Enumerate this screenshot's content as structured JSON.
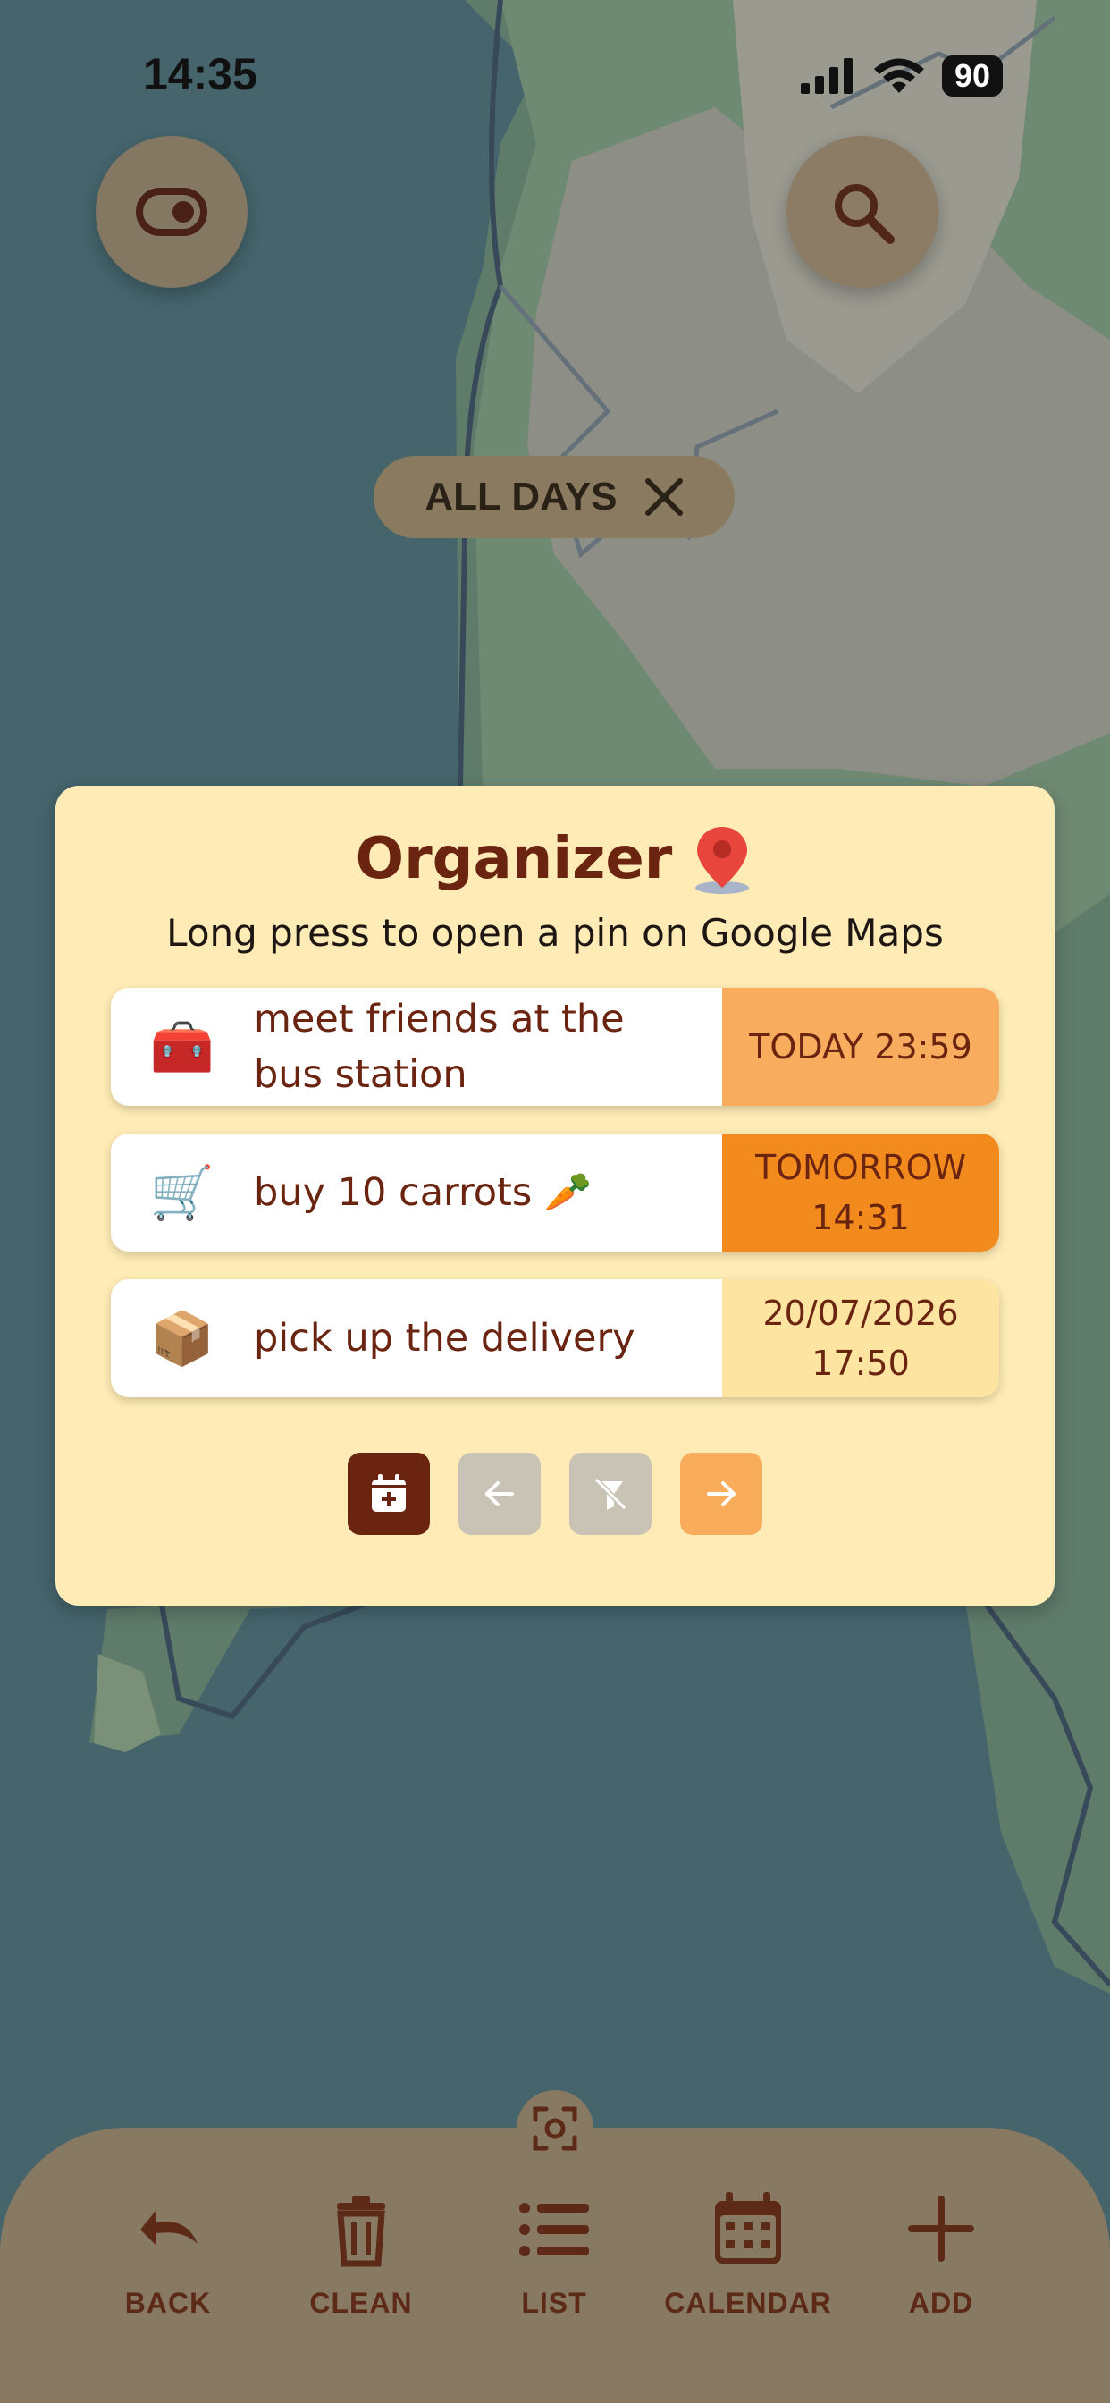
{
  "status_bar": {
    "time": "14:35",
    "battery": "90"
  },
  "top_controls": {
    "toggle_icon": "toggle-icon",
    "search_icon": "search-icon"
  },
  "filter_chip": {
    "label": "ALL DAYS",
    "close_icon": "close-icon"
  },
  "organizer": {
    "title": "Organizer",
    "title_icon": "map-pin-icon",
    "subtitle": "Long press to open a pin on Google Maps",
    "items": [
      {
        "icon": "🧰",
        "icon_name": "treasure-chest-icon",
        "text": "meet friends at the bus station",
        "date": "TODAY 23:59",
        "date_color": "#f8ad5e"
      },
      {
        "icon": "🛒",
        "icon_name": "shopping-cart-icon",
        "text": "buy 10 carrots 🥕",
        "date": "TOMORROW 14:31",
        "date_color": "#f28a1d"
      },
      {
        "icon": "📦",
        "icon_name": "package-icon",
        "text": "pick up the delivery",
        "date": "20/07/2026 17:50",
        "date_color": "#fde4a0"
      }
    ],
    "pager": [
      {
        "name": "calendar-add-icon",
        "color": "#6a2410"
      },
      {
        "name": "arrow-left-icon",
        "color": "#c9c3b6"
      },
      {
        "name": "filter-off-icon",
        "color": "#c9c3b6"
      },
      {
        "name": "arrow-right-icon",
        "color": "#f9ad5a"
      }
    ]
  },
  "bottom_nav": {
    "scan_icon": "scan-icon",
    "items": [
      {
        "label": "BACK",
        "icon": "undo-icon"
      },
      {
        "label": "CLEAN",
        "icon": "trash-icon"
      },
      {
        "label": "LIST",
        "icon": "list-icon"
      },
      {
        "label": "CALENDAR",
        "icon": "calendar-icon"
      },
      {
        "label": "ADD",
        "icon": "plus-icon"
      }
    ]
  }
}
